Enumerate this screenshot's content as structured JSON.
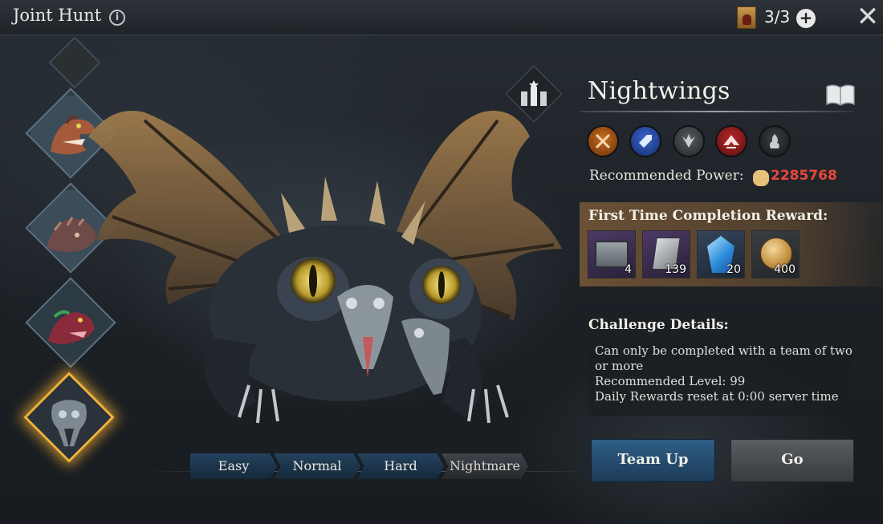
{
  "header": {
    "title": "Joint Hunt",
    "info_icon": "info-icon",
    "keys": "3/3",
    "wanted_icon": "wanted-poster-icon",
    "add_icon": "plus-icon",
    "close_icon": "close-icon"
  },
  "bosses": [
    {
      "name": "partial-top",
      "selected": false
    },
    {
      "name": "green-lizard",
      "selected": false
    },
    {
      "name": "brown-beast",
      "selected": false
    },
    {
      "name": "red-serpent",
      "selected": false
    },
    {
      "name": "nightwings",
      "selected": true
    }
  ],
  "difficulty_tabs": [
    {
      "label": "Easy",
      "active": false
    },
    {
      "label": "Normal",
      "active": false
    },
    {
      "label": "Hard",
      "active": false
    },
    {
      "label": "Nightmare",
      "active": true
    }
  ],
  "boss": {
    "name": "Nightwings",
    "affinities": [
      "orange-crossed-swords-icon",
      "blue-shield-icon",
      "grey-wings-icon",
      "red-strength-icon",
      "dark-flame-icon"
    ],
    "recommended_power_label": "Recommended Power:",
    "recommended_power_value": "2285768"
  },
  "rewards": {
    "title": "First Time Completion Reward:",
    "items": [
      {
        "icon": "chest-icon",
        "count": "4"
      },
      {
        "icon": "tome-icon",
        "count": "139"
      },
      {
        "icon": "crystal-icon",
        "count": "20"
      },
      {
        "icon": "coin-icon",
        "count": "400"
      }
    ]
  },
  "challenge": {
    "title": "Challenge Details:",
    "lines": [
      "Can only be completed with a team of two",
      "or more",
      "Recommended Level: 99",
      "Daily Rewards reset at 0:00 server time"
    ]
  },
  "buttons": {
    "team_up": "Team Up",
    "go": "Go"
  },
  "colors": {
    "power_value": "#e9463d",
    "selected_glow": "#f0b23a",
    "team_button": "#2f5f86"
  }
}
